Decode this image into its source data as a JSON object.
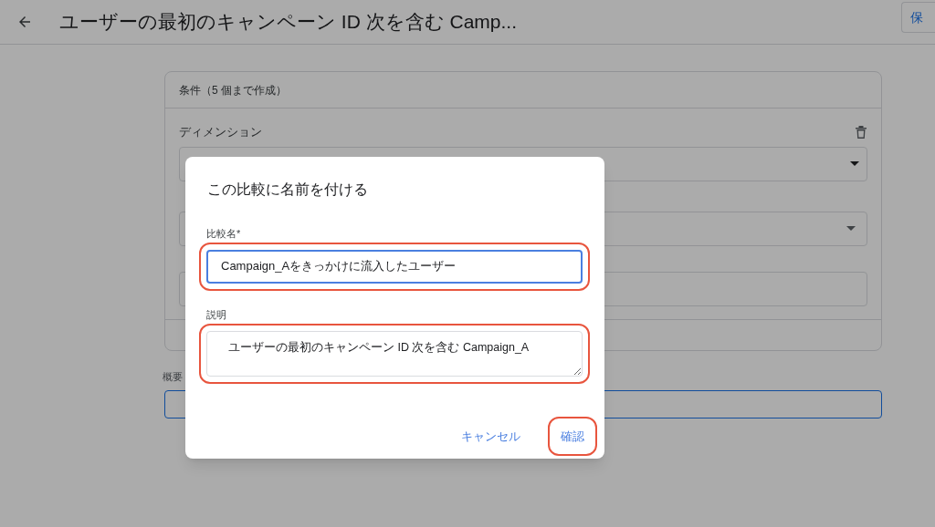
{
  "header": {
    "title": "ユーザーの最初のキャンペーン ID 次を含む Camp...",
    "save_button": "保"
  },
  "conditions_card": {
    "heading": "条件（5 個まで作成）",
    "dimension_label": "ディメンション"
  },
  "summary": {
    "label": "概要"
  },
  "dialog": {
    "title": "この比較に名前を付ける",
    "fields": [
      {
        "kind": "input",
        "label": "比較名*",
        "value": "Campaign_Aをきっかけに流入したユーザー",
        "focused": true,
        "highlighted": true
      },
      {
        "kind": "textarea",
        "label": "説明",
        "value": "ユーザーの最初のキャンペーン ID 次を含む Campaign_A",
        "focused": false,
        "highlighted": true
      }
    ],
    "buttons": [
      {
        "label": "キャンセル",
        "highlighted": false
      },
      {
        "label": "確認",
        "highlighted": true
      }
    ]
  }
}
